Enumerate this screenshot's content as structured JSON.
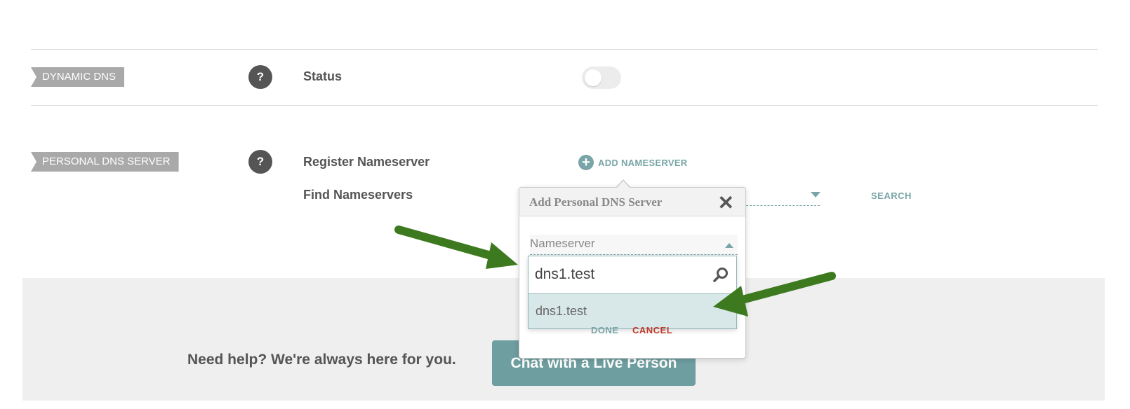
{
  "dynamic_dns": {
    "tag": "DYNAMIC DNS",
    "help_icon": "?",
    "status_label": "Status",
    "status_enabled": false
  },
  "personal_dns": {
    "tag": "PERSONAL DNS SERVER",
    "help_icon": "?",
    "register_label": "Register Nameserver",
    "add_nameserver_label": "ADD NAMESERVER",
    "find_label": "Find Nameservers",
    "search_label": "SEARCH"
  },
  "popup": {
    "title": "Add Personal DNS Server",
    "close_glyph": "✕",
    "select_label": "Nameserver",
    "search_value": "dns1.test",
    "options": [
      "dns1.test"
    ],
    "done_label": "DONE",
    "cancel_label": "CANCEL"
  },
  "help_band": {
    "text": "Need help? We're always here for you.",
    "chat_button": "Chat with a Live Person"
  },
  "colors": {
    "accent": "#79a5a8",
    "cancel": "#c0392b",
    "arrow": "#3d7a1f"
  }
}
